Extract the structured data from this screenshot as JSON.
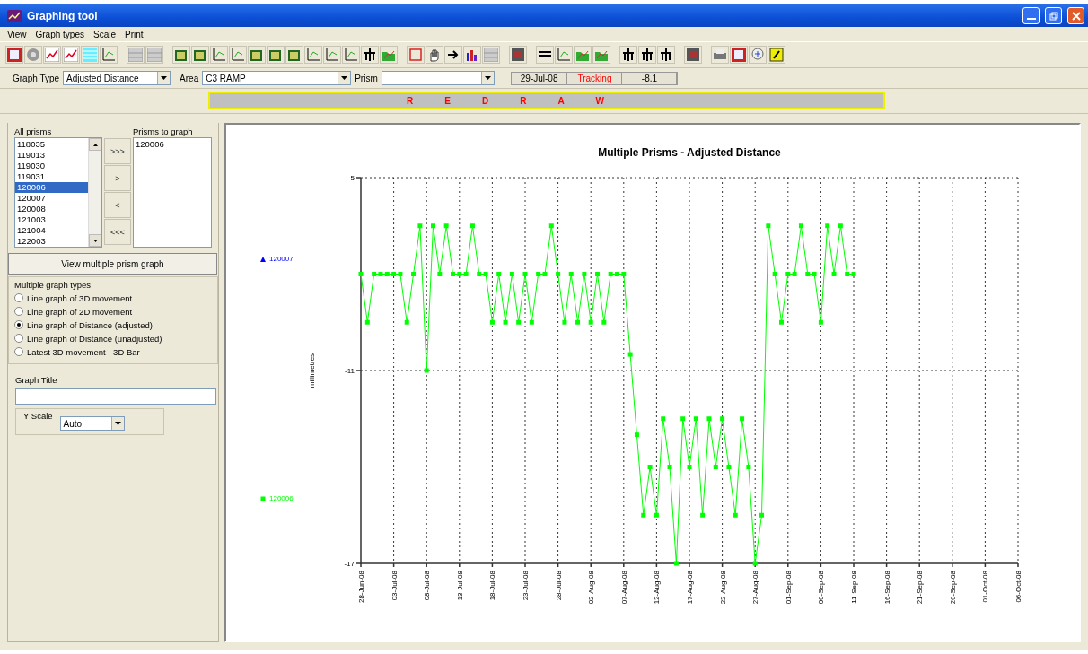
{
  "window": {
    "title": "Graphing tool"
  },
  "menu": [
    "View",
    "Graph types",
    "Scale",
    "Print"
  ],
  "filters": {
    "graph_type": {
      "label": "Graph Type",
      "value": "Adjusted Distance"
    },
    "area": {
      "label": "Area",
      "value": "C3 RAMP"
    },
    "prism": {
      "label": "Prism"
    }
  },
  "status": [
    {
      "text": "29-Jul-08",
      "kind": "normal"
    },
    {
      "text": "Tracking",
      "kind": "alert"
    },
    {
      "text": "-8.1",
      "kind": "normal"
    }
  ],
  "redraw_button": {
    "letters": [
      "R",
      "E",
      "D",
      "R",
      "A",
      "W"
    ]
  },
  "all_prisms": {
    "label": "All prisms",
    "items": [
      {
        "text": "118035",
        "selected": false
      },
      {
        "text": "119013",
        "selected": false
      },
      {
        "text": "119030",
        "selected": false
      },
      {
        "text": "119031",
        "selected": false
      },
      {
        "text": "120006",
        "selected": true
      },
      {
        "text": "120007",
        "selected": false
      },
      {
        "text": "120008",
        "selected": false
      },
      {
        "text": "121003",
        "selected": false
      },
      {
        "text": "121004",
        "selected": false
      },
      {
        "text": "122003",
        "selected": false
      }
    ]
  },
  "move_buttons": [
    ">>>",
    ">",
    "<",
    "<<<"
  ],
  "prisms_to_graph": {
    "label": "Prisms to graph",
    "items": [
      {
        "text": "120006",
        "selected": false
      }
    ]
  },
  "view_button": "View multiple prism graph",
  "graph_types": {
    "label": "Multiple graph types",
    "options": [
      {
        "text": "Line graph of 3D movement",
        "selected": false
      },
      {
        "text": "Line graph of 2D movement",
        "selected": false
      },
      {
        "text": "Line graph of Distance (adjusted)",
        "selected": true
      },
      {
        "text": "Line graph of Distance (unadjusted)",
        "selected": false
      },
      {
        "text": "Latest 3D movement - 3D Bar",
        "selected": false
      }
    ]
  },
  "graph_title": {
    "label": "Graph Title"
  },
  "y_scale": {
    "label": "Y Scale",
    "value": "Auto"
  },
  "chart": {
    "chart_data": {
      "type": "line",
      "title": "Multiple Prisms - Adjusted Distance",
      "ylabel": "millimetres",
      "ylim": [
        -17,
        -5
      ],
      "grid": true,
      "yticks": [
        -5,
        -11,
        -17
      ],
      "categories": [
        "28-Jun-08",
        null,
        null,
        null,
        null,
        "03-Jul-08",
        null,
        null,
        null,
        null,
        "08-Jul-08",
        null,
        null,
        null,
        null,
        "13-Jul-08",
        null,
        null,
        null,
        null,
        "18-Jul-08",
        null,
        null,
        null,
        null,
        "23-Jul-08",
        null,
        null,
        null,
        null,
        "28-Jul-08",
        null,
        null,
        null,
        null,
        "02-Aug-08",
        null,
        null,
        null,
        null,
        "07-Aug-08",
        null,
        null,
        null,
        null,
        "12-Aug-08",
        null,
        null,
        null,
        null,
        "17-Aug-08",
        null,
        null,
        null,
        null,
        "22-Aug-08",
        null,
        null,
        null,
        null,
        "27-Aug-08",
        null,
        null,
        null,
        null,
        "01-Sep-08",
        null,
        null,
        null,
        null,
        "06-Sep-08",
        null,
        null,
        null,
        null,
        "11-Sep-08",
        null,
        null,
        null,
        null,
        "16-Sep-08",
        null,
        null,
        null,
        null,
        "21-Sep-08",
        null,
        null,
        null,
        null,
        "26-Sep-08",
        null,
        null,
        null,
        null,
        "01-Oct-08",
        null,
        null,
        null,
        null,
        "06-Oct-08"
      ],
      "series": [
        {
          "name": "120007",
          "color": "#0000ff",
          "marker": "triangle",
          "values": [
            null,
            null,
            null,
            null,
            null,
            null,
            null,
            null,
            null,
            null,
            null,
            null,
            null,
            null,
            null,
            null,
            null,
            null,
            null,
            null,
            null,
            null,
            null,
            null,
            null,
            null,
            null,
            null,
            null,
            null,
            null,
            null,
            null,
            null,
            null,
            null,
            null,
            null,
            null,
            null,
            null,
            null,
            null,
            null,
            null,
            null,
            null,
            null,
            null,
            null,
            null,
            null,
            null,
            null,
            null,
            null,
            null,
            null,
            null,
            null,
            null,
            null,
            null,
            null,
            null,
            null,
            null,
            null,
            null,
            null,
            null,
            null,
            null,
            null,
            null,
            null,
            null,
            null,
            null,
            null,
            null,
            null,
            null,
            null,
            null,
            null,
            null,
            null,
            null,
            null,
            null,
            null,
            null,
            null,
            null,
            null,
            null,
            null,
            null,
            null,
            null
          ]
        },
        {
          "name": "120006",
          "color": "#00ff00",
          "marker": "square",
          "values": [
            -8,
            -9.5,
            -8,
            -8,
            -8,
            -8,
            -8,
            -9.5,
            -8,
            -6.5,
            -11,
            -6.5,
            -8,
            -6.5,
            -8,
            -8,
            -8,
            -6.5,
            -8,
            -8,
            -9.5,
            -8,
            -9.5,
            -8,
            -9.5,
            -8,
            -9.5,
            -8,
            -8,
            -6.5,
            -8,
            -9.5,
            -8,
            -9.5,
            -8,
            -9.5,
            -8,
            -9.5,
            -8,
            -8,
            -8,
            -10.5,
            -13,
            -15.5,
            -14,
            -15.5,
            -12.5,
            -14,
            -17,
            -12.5,
            -14,
            -12.5,
            -15.5,
            -12.5,
            -14,
            -12.5,
            -14,
            -15.5,
            -12.5,
            -14,
            -17,
            -15.5,
            -6.5,
            -8,
            -9.5,
            -8,
            -8,
            -6.5,
            -8,
            -8,
            -9.5,
            -6.5,
            -8,
            -6.5,
            -8,
            -8,
            null,
            null,
            null,
            null,
            null,
            null,
            null,
            null,
            null,
            null,
            null,
            null,
            null,
            null,
            null,
            null,
            null,
            null,
            null,
            null,
            null,
            null,
            null,
            null,
            null
          ]
        }
      ]
    }
  }
}
